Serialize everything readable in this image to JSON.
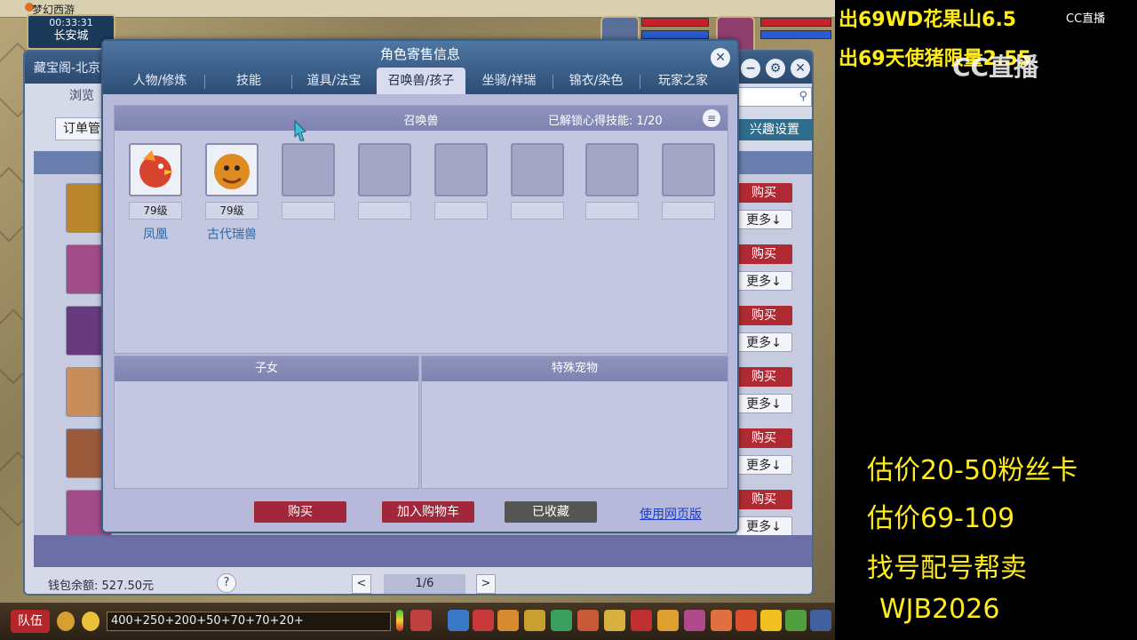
{
  "window": {
    "app_title": "梦幻西游",
    "clock": "00:33:31",
    "location": "长安城"
  },
  "background_window": {
    "title": "藏宝阁-北京",
    "subtab": "浏览",
    "order_mgmt": "订单管",
    "interest_btn": "兴趣设置",
    "rows": [
      {
        "buy": "购买",
        "more": "更多↓"
      },
      {
        "buy": "购买",
        "more": "更多↓"
      },
      {
        "buy": "购买",
        "more": "更多↓"
      },
      {
        "buy": "购买",
        "more": "更多↓"
      },
      {
        "buy": "购买",
        "more": "更多↓"
      },
      {
        "buy": "购买",
        "more": "更多↓"
      }
    ],
    "wallet": "钱包余额: 527.50元",
    "help": "?",
    "pager": "1/6",
    "prev": "<",
    "next": ">"
  },
  "dialog": {
    "title": "角色寄售信息",
    "close": "✕",
    "tabs": [
      "人物/修炼",
      "技能",
      "道具/法宝",
      "召唤兽/孩子",
      "坐骑/祥瑞",
      "锦衣/染色",
      "玩家之家"
    ],
    "active_tab_index": 3,
    "pets_title": "召唤兽",
    "skill_label": "已解锁心得技能: 1/20",
    "skill_menu_icon": "≡",
    "pets": [
      {
        "level": "79级",
        "name": "凤凰",
        "color": "#d8452f"
      },
      {
        "level": "79级",
        "name": "古代瑞兽",
        "color": "#e08a22"
      },
      {
        "level": "",
        "name": ""
      },
      {
        "level": "",
        "name": ""
      },
      {
        "level": "",
        "name": ""
      },
      {
        "level": "",
        "name": ""
      },
      {
        "level": "",
        "name": ""
      },
      {
        "level": "",
        "name": ""
      }
    ],
    "kids_title": "子女",
    "special_title": "特殊宠物",
    "buy": "购买",
    "add_cart": "加入购物车",
    "favorited": "已收藏",
    "web_link": "使用网页版"
  },
  "bottom_bar": {
    "team": "队伍",
    "chat_text": "400+250+200+50+70+70+20+"
  },
  "overlays": {
    "top_lines": [
      "出69WD花果山6.5",
      "出69天使猪限量2.55"
    ],
    "cc_logo": "CC直播",
    "cc_watermark": "CC直播",
    "right_lines": [
      "估价20-50粉丝卡",
      "估价69-109",
      "找号配号帮卖",
      "WJB2026"
    ]
  }
}
